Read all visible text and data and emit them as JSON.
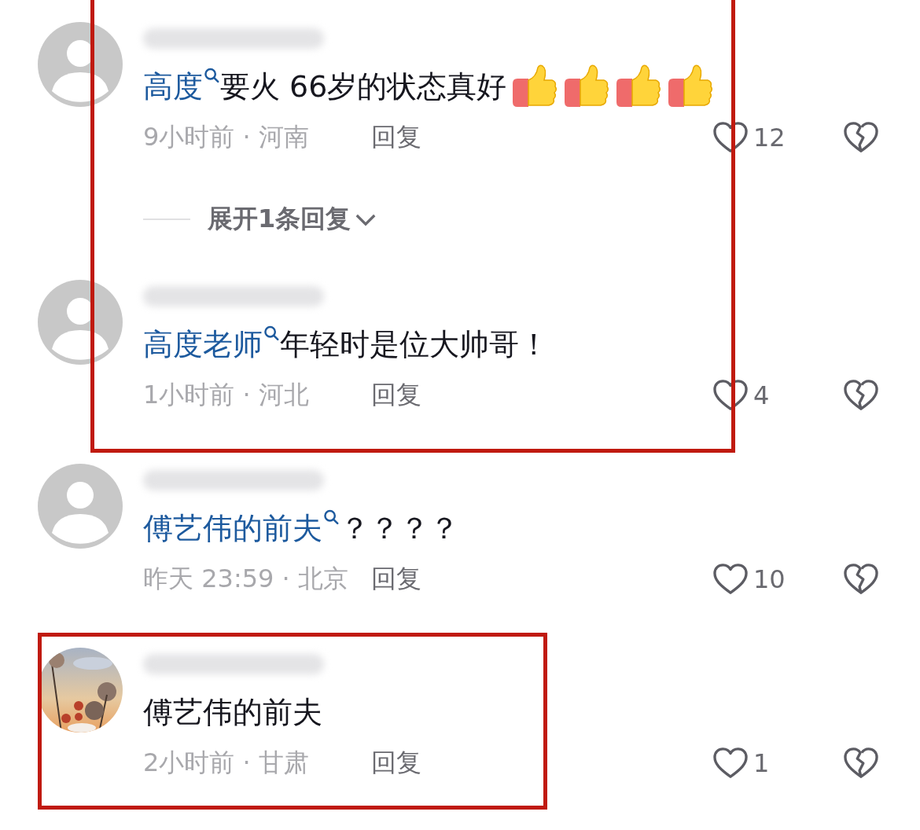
{
  "comments": [
    {
      "avatar": {
        "kind": "default"
      },
      "mention": "高度",
      "text": "要火  66岁的状态真好",
      "emojis": [
        {
          "kind": "thumbs-up"
        },
        {
          "kind": "thumbs-up"
        },
        {
          "kind": "thumbs-up"
        },
        {
          "kind": "thumbs-up"
        }
      ],
      "time": "9小时前 · 河南",
      "reply": "回复",
      "likes": "12",
      "expand": "展开1条回复",
      "framed": true
    },
    {
      "avatar": {
        "kind": "default"
      },
      "mention": "高度老师",
      "text": "年轻时是位大帅哥！",
      "time": "1小时前 · 河北",
      "reply": "回复",
      "likes": "4",
      "framed": true
    },
    {
      "avatar": {
        "kind": "default"
      },
      "mention": "傅艺伟的前夫",
      "text": "？？？？",
      "time": "昨天 23:59 · 北京",
      "reply": "回复",
      "likes": "10",
      "framed": false
    },
    {
      "text": "傅艺伟的前夫",
      "time": "2小时前 · 甘肃",
      "reply": "回复",
      "likes": "1",
      "framed": true
    }
  ]
}
